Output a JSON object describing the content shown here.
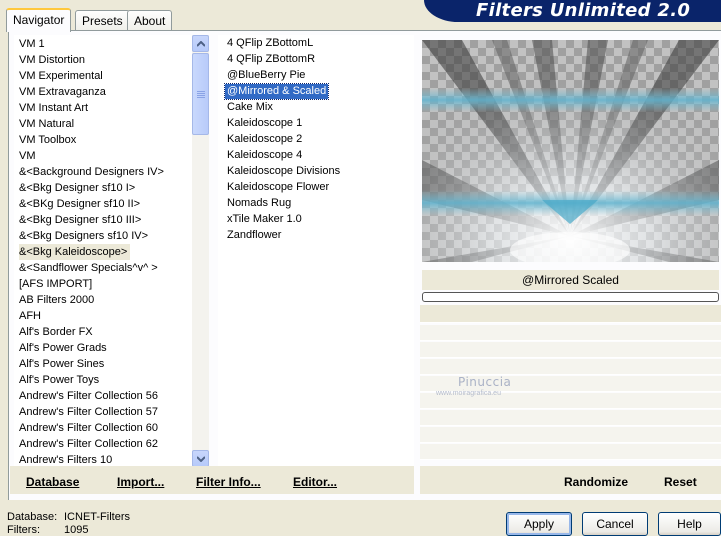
{
  "tabs": [
    {
      "label": "Navigator",
      "active": true
    },
    {
      "label": "Presets",
      "active": false
    },
    {
      "label": "About",
      "active": false
    }
  ],
  "banner_title": "Filters Unlimited 2.0",
  "categories": [
    {
      "label": "VM 1",
      "selected": false
    },
    {
      "label": "VM Distortion",
      "selected": false
    },
    {
      "label": "VM Experimental",
      "selected": false
    },
    {
      "label": "VM Extravaganza",
      "selected": false
    },
    {
      "label": "VM Instant Art",
      "selected": false
    },
    {
      "label": "VM Natural",
      "selected": false
    },
    {
      "label": "VM Toolbox",
      "selected": false
    },
    {
      "label": "VM",
      "selected": false
    },
    {
      "label": "&<Background Designers IV>",
      "selected": false
    },
    {
      "label": "&<Bkg Designer sf10 I>",
      "selected": false
    },
    {
      "label": "&<BKg Designer sf10 II>",
      "selected": false
    },
    {
      "label": "&<Bkg Designer sf10 III>",
      "selected": false
    },
    {
      "label": "&<Bkg Designers sf10 IV>",
      "selected": false
    },
    {
      "label": "&<Bkg Kaleidoscope>",
      "selected": true
    },
    {
      "label": "&<Sandflower Specials^v^ >",
      "selected": false
    },
    {
      "label": "[AFS IMPORT]",
      "selected": false
    },
    {
      "label": "AB Filters 2000",
      "selected": false
    },
    {
      "label": "AFH",
      "selected": false
    },
    {
      "label": "Alf's Border FX",
      "selected": false
    },
    {
      "label": "Alf's Power Grads",
      "selected": false
    },
    {
      "label": "Alf's Power Sines",
      "selected": false
    },
    {
      "label": "Alf's Power Toys",
      "selected": false
    },
    {
      "label": "Andrew's Filter Collection 56",
      "selected": false
    },
    {
      "label": "Andrew's Filter Collection 57",
      "selected": false
    },
    {
      "label": "Andrew's Filter Collection 60",
      "selected": false
    },
    {
      "label": "Andrew's Filter Collection 62",
      "selected": false
    },
    {
      "label": "Andrew's Filters 10",
      "selected": false
    }
  ],
  "filters": [
    {
      "label": "4 QFlip ZBottomL",
      "selected": false
    },
    {
      "label": "4 QFlip ZBottomR",
      "selected": false
    },
    {
      "label": "@BlueBerry Pie",
      "selected": false
    },
    {
      "label": "@Mirrored & Scaled",
      "selected": true
    },
    {
      "label": "Cake Mix",
      "selected": false
    },
    {
      "label": "Kaleidoscope 1",
      "selected": false
    },
    {
      "label": "Kaleidoscope 2",
      "selected": false
    },
    {
      "label": "Kaleidoscope 4",
      "selected": false
    },
    {
      "label": "Kaleidoscope Divisions",
      "selected": false
    },
    {
      "label": "Kaleidoscope Flower",
      "selected": false
    },
    {
      "label": "Nomads Rug",
      "selected": false
    },
    {
      "label": "xTile Maker 1.0",
      "selected": false
    },
    {
      "label": "Zandflower",
      "selected": false
    }
  ],
  "preview_filter_name": "@Mirrored  Scaled",
  "watermark": {
    "name": "Pinuccia",
    "url": "www.moiragrafica.eu"
  },
  "toolbar": {
    "database": "Database",
    "import": "Import...",
    "filter_info": "Filter Info...",
    "editor": "Editor...",
    "randomize": "Randomize",
    "reset": "Reset"
  },
  "status": {
    "database_label": "Database:",
    "database_value": "ICNET-Filters",
    "filters_label": "Filters:",
    "filters_value": "1095"
  },
  "dialog": {
    "apply": "Apply",
    "cancel": "Cancel",
    "help": "Help"
  },
  "colors": {
    "banner": "#0a246a",
    "selection": "#316ac5",
    "tab_highlight": "#ffc83c"
  },
  "icons": [
    "scroll-up-arrow-icon",
    "scroll-down-arrow-icon"
  ]
}
